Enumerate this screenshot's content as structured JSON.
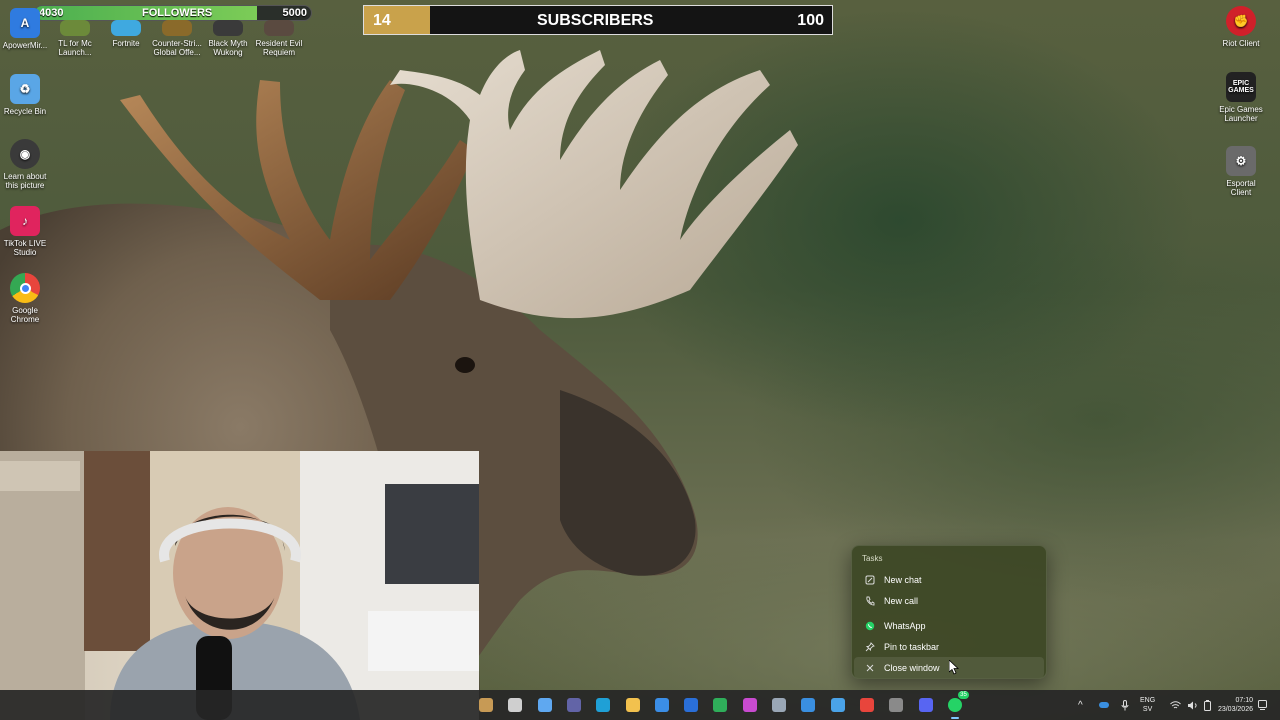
{
  "overlays": {
    "followers": {
      "current": "4030",
      "label": "FOLLOWERS",
      "goal": "5000",
      "progress": 0.806
    },
    "subscribers": {
      "current": "14",
      "label": "SUBSCRIBERS",
      "goal": "100",
      "progress": 0.14
    }
  },
  "desktop_left": [
    {
      "label": "ApowerMir...",
      "icon": "apowermirror-icon",
      "color": "#2f7be0"
    },
    {
      "label": "Recycle Bin",
      "icon": "recycle-bin-icon",
      "color": "#5aa6e6"
    },
    {
      "label": "Learn about this picture",
      "icon": "camera-icon",
      "color": "#3a3a3a"
    },
    {
      "label": "TikTok LIVE Studio",
      "icon": "tiktok-icon",
      "color": "#e0245e"
    },
    {
      "label": "Google Chrome",
      "icon": "chrome-icon",
      "color": "#e8453c"
    }
  ],
  "desktop_top": [
    {
      "label": "TL for Mc Launch...",
      "icon": "tlauncher-icon",
      "color": "#6c8a3a"
    },
    {
      "label": "Fortnite",
      "icon": "fortnite-icon",
      "color": "#3fa9e0"
    },
    {
      "label": "Counter-Stri... Global Offe...",
      "icon": "csgo-icon",
      "color": "#8a6a2a"
    },
    {
      "label": "Black Myth Wukong",
      "icon": "black-myth-icon",
      "color": "#3a3a3a"
    },
    {
      "label": "Resident Evil Requiem",
      "icon": "resident-evil-icon",
      "color": "#5a4a40"
    }
  ],
  "desktop_right": [
    {
      "label": "Riot Client",
      "icon": "riot-icon",
      "color": "#d0202a"
    },
    {
      "label": "Epic Games Launcher",
      "icon": "epic-games-icon",
      "color": "#222222",
      "glyph": "EPIC GAMES"
    },
    {
      "label": "Esportal Client",
      "icon": "esportal-icon",
      "color": "#6a6a6a"
    }
  ],
  "jumplist": {
    "section": "Tasks",
    "items": [
      {
        "label": "New chat",
        "icon": "new-chat-icon"
      },
      {
        "label": "New call",
        "icon": "phone-icon"
      }
    ],
    "app_items": [
      {
        "label": "WhatsApp",
        "icon": "whatsapp-icon"
      },
      {
        "label": "Pin to taskbar",
        "icon": "pin-icon"
      },
      {
        "label": "Close window",
        "icon": "close-icon"
      }
    ]
  },
  "taskbar": {
    "apps": [
      {
        "name": "webcam-app-icon",
        "color": "#c79a55"
      },
      {
        "name": "task-view-icon",
        "color": "#cfcfcf"
      },
      {
        "name": "copilot-icon",
        "color": "#5fa8f0"
      },
      {
        "name": "teams-icon",
        "color": "#6264a7"
      },
      {
        "name": "edge-icon",
        "color": "#1fa0d6"
      },
      {
        "name": "file-explorer-icon",
        "color": "#f2c14e"
      },
      {
        "name": "store-icon",
        "color": "#3b8ee6"
      },
      {
        "name": "app-blue-icon",
        "color": "#2a6fd8"
      },
      {
        "name": "vpn-icon",
        "color": "#2fae5a"
      },
      {
        "name": "m365-icon",
        "color": "#c94bd0"
      },
      {
        "name": "vscode-icon",
        "color": "#9aa7b6"
      },
      {
        "name": "monitor-app-icon",
        "color": "#3a8fe0"
      },
      {
        "name": "snipping-tool-icon",
        "color": "#4aa3e8"
      },
      {
        "name": "chrome-taskbar-icon",
        "color": "#e8453c"
      },
      {
        "name": "settings-app-icon",
        "color": "#8a8a8a"
      },
      {
        "name": "discord-icon",
        "color": "#5865f2"
      },
      {
        "name": "whatsapp-taskbar-icon",
        "color": "#25d366"
      }
    ],
    "whatsapp_badge": "35",
    "language_top": "ENG",
    "language_bottom": "SV",
    "time": "07:10",
    "date": "23/03/2026"
  }
}
